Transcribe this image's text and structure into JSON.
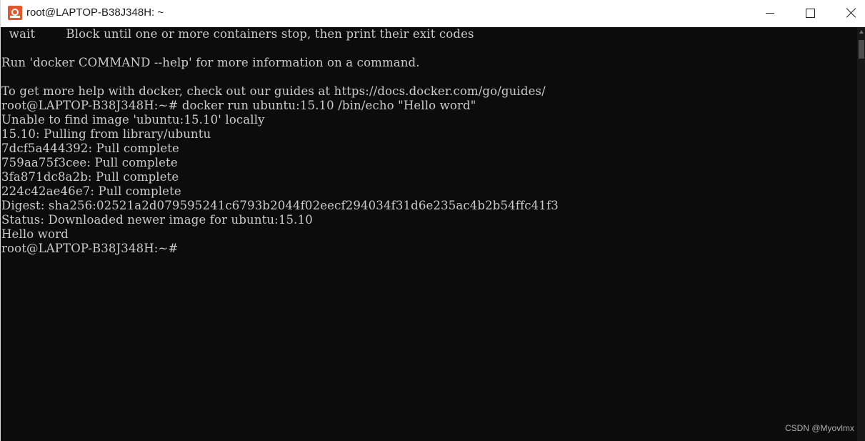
{
  "window": {
    "title": "root@LAPTOP-B38J348H: ~",
    "app_icon": "ubuntu-terminal-icon",
    "controls": {
      "minimize_icon": "minimize-icon",
      "maximize_icon": "maximize-icon",
      "close_icon": "close-icon"
    }
  },
  "terminal": {
    "background": "#0c0c0c",
    "foreground": "#cccccc",
    "lines": [
      "  wait        Block until one or more containers stop, then print their exit codes",
      "",
      "Run 'docker COMMAND --help' for more information on a command.",
      "",
      "To get more help with docker, check out our guides at https://docs.docker.com/go/guides/",
      "root@LAPTOP-B38J348H:~# docker run ubuntu:15.10 /bin/echo \"Hello word\"",
      "Unable to find image 'ubuntu:15.10' locally",
      "15.10: Pulling from library/ubuntu",
      "7dcf5a444392: Pull complete",
      "759aa75f3cee: Pull complete",
      "3fa871dc8a2b: Pull complete",
      "224c42ae46e7: Pull complete",
      "Digest: sha256:02521a2d079595241c6793b2044f02eecf294034f31d6e235ac4b2b54ffc41f3",
      "Status: Downloaded newer image for ubuntu:15.10",
      "Hello word",
      "root@LAPTOP-B38J348H:~#"
    ]
  },
  "watermark": "CSDN @Myovlmx"
}
